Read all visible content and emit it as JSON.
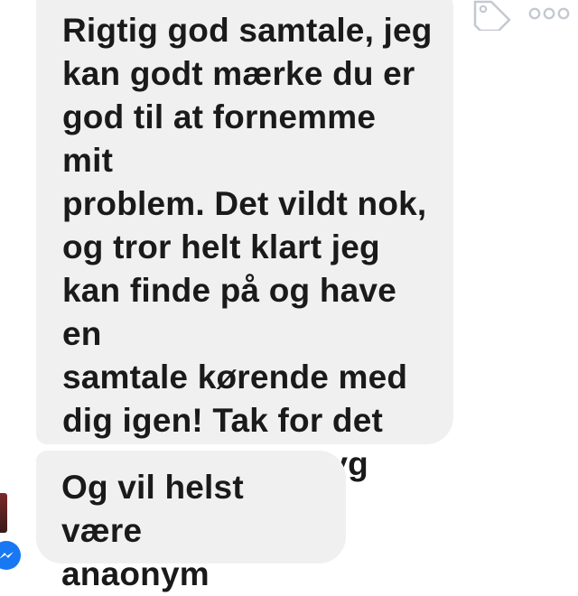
{
  "colors": {
    "bubble_background": "#f1f0f0",
    "text": "#1a1a1a",
    "messenger_blue": "#1877f2",
    "icon_gray": "#c4c8cf"
  },
  "icons": {
    "tag": "tag-icon",
    "more": "more-options-icon",
    "messenger": "messenger-icon"
  },
  "messages": [
    {
      "text": "Rigtig god samtale, jeg\nkan godt mærke du er\ngod til at fornemme mit\nproblem. Det vildt nok,\nog tror helt klart jeg\nkan finde på og have en\nsamtale kørende med\ndig igen! Tak for det\nhele, du er sindsyg god\nmashallah."
    },
    {
      "text": "Og vil helst være\nanaonym"
    }
  ]
}
